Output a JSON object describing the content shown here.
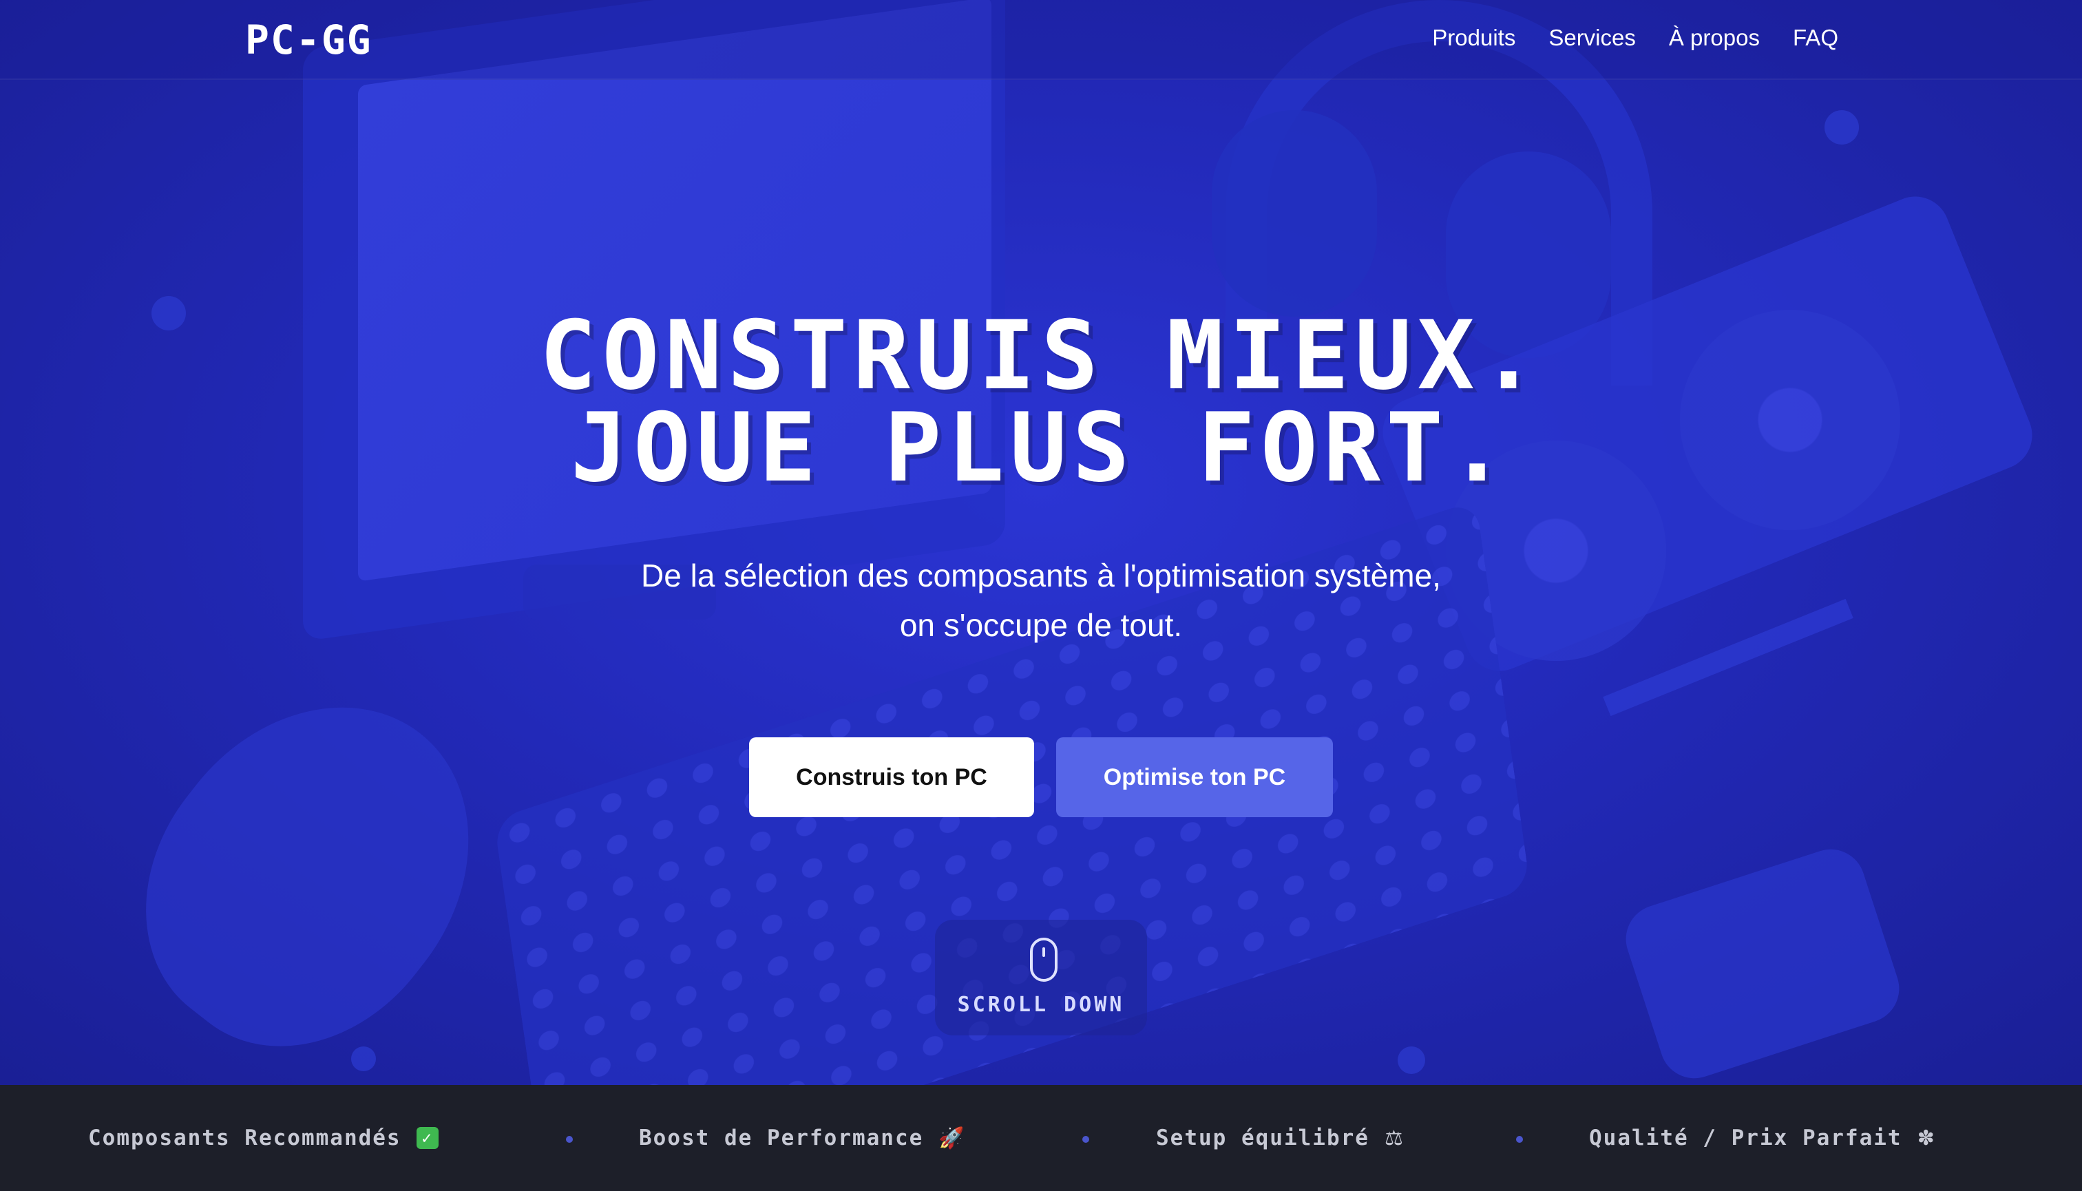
{
  "brand": {
    "logo": "PC-GG"
  },
  "nav": {
    "links": [
      "Produits",
      "Services",
      "À propos",
      "FAQ"
    ]
  },
  "hero": {
    "headline_line1": "CONSTRUIS MIEUX.",
    "headline_line2": "JOUE PLUS FORT.",
    "subtitle_line1": "De la sélection des composants à l'optimisation système,",
    "subtitle_line2": "on s'occupe de tout.",
    "cta_primary": "Construis ton PC",
    "cta_secondary": "Optimise ton PC",
    "scroll_label": "SCROLL DOWN"
  },
  "ticker": {
    "items": [
      {
        "label": "Composants Recommandés",
        "icon": "check-mark-icon",
        "glyph": "✓"
      },
      {
        "label": "Boost de Performance",
        "icon": "rocket-icon",
        "glyph": "🚀"
      },
      {
        "label": "Setup équilibré",
        "icon": "balance-scale-icon",
        "glyph": "⚖"
      },
      {
        "label": "Qualité / Prix Parfait",
        "icon": "pinwheel-icon",
        "glyph": "✽"
      }
    ]
  },
  "colors": {
    "hero_bg": "#2229b8",
    "accent_button": "#5665e8",
    "ticker_bg": "#1d1f29",
    "ticker_dot": "#4a55cc"
  }
}
